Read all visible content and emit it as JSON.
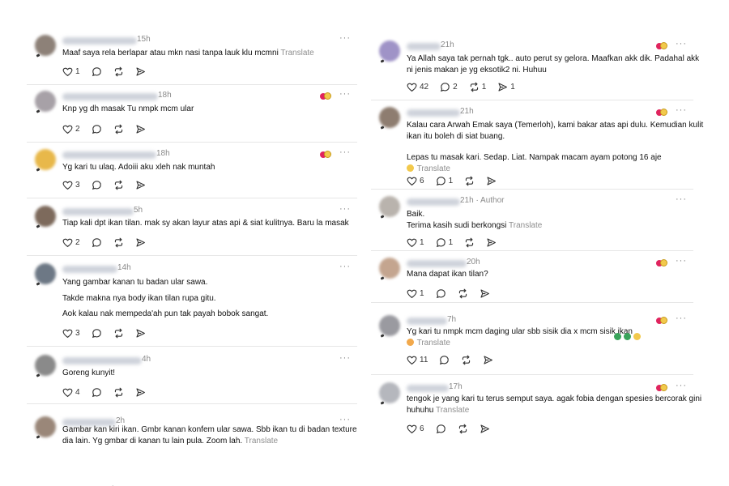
{
  "left_posts": [
    {
      "time": "15h",
      "lines": [
        "Maaf saya rela berlapar atau mkn nasi tanpa lauk klu mcmni"
      ],
      "translate": "Translate",
      "likes": "1",
      "replies": "",
      "reposts": "",
      "shares": "",
      "has_reactions": false,
      "avatar_color": "#8d8178"
    },
    {
      "time": "18h",
      "lines": [
        "Knp yg dh masak Tu nmpk mcm ular"
      ],
      "translate": "",
      "likes": "2",
      "replies": "",
      "reposts": "",
      "shares": "",
      "has_reactions": true,
      "avatar_color": "#a7a1a7"
    },
    {
      "time": "18h",
      "lines": [
        "Yg kari tu ulaq. Adoiii aku xleh nak muntah"
      ],
      "translate": "",
      "likes": "3",
      "replies": "",
      "reposts": "",
      "shares": "",
      "has_reactions": true,
      "avatar_color": "#e8b84a"
    },
    {
      "time": "5h",
      "lines": [
        "Tiap kali dpt ikan tilan. mak sy akan layur atas api & siat kulitnya. Baru la masak"
      ],
      "translate": "",
      "likes": "2",
      "replies": "",
      "reposts": "",
      "shares": "",
      "has_reactions": false,
      "avatar_color": "#7d6a5c"
    },
    {
      "time": "14h",
      "lines": [
        "Yang gambar kanan tu badan ular sawa.",
        "Takde makna nya body ikan tilan rupa gitu.",
        "Aok kalau nak mempeda'ah pun tak payah bobok sangat."
      ],
      "translate": "",
      "likes": "3",
      "replies": "",
      "reposts": "",
      "shares": "",
      "has_reactions": false,
      "avatar_color": "#6d7885"
    },
    {
      "time": "4h",
      "lines": [
        "Goreng kunyit!"
      ],
      "translate": "",
      "likes": "4",
      "replies": "",
      "reposts": "",
      "shares": "",
      "has_reactions": false,
      "avatar_color": "#8a8a8a"
    },
    {
      "time": "2h",
      "lines": [
        "Gambar kan kiri ikan. Gmbr kanan konfem ular sawa. Sbb ikan tu di badan texture",
        "dia lain. Yg gmbar di kanan tu lain pula. Zoom lah."
      ],
      "translate": "Translate",
      "likes": "",
      "replies": "",
      "reposts": "",
      "shares": "",
      "has_reactions": false,
      "avatar_color": "#9a8779"
    }
  ],
  "right_posts": [
    {
      "time": "21h",
      "lines": [
        "Ya Allah saya tak pernah tgk.. auto perut sy gelora. Maafkan akk dik. Padahal akk",
        "ni jenis makan je yg eksotik2 ni. Huhuu"
      ],
      "translate": "",
      "likes": "42",
      "replies": "2",
      "reposts": "1",
      "shares": "1",
      "has_reactions": true,
      "avatar_color": "#9f93c7"
    },
    {
      "time": "21h",
      "lines": [
        "Kalau cara Arwah Emak saya (Temerloh), kami bakar atas api dulu. Kemudian kulit",
        "ikan itu boleh di siat buang.",
        "",
        "Lepas tu masak kari. Sedap. Liat. Nampak macam ayam potong 16 aje"
      ],
      "translate": "Translate",
      "likes": "6",
      "replies": "1",
      "reposts": "",
      "shares": "",
      "has_reactions": true,
      "avatar_color": "#8e7d70"
    },
    {
      "time": "21h · Author",
      "lines": [
        "Baik.",
        "Terima kasih sudi berkongsi"
      ],
      "translate": "Translate",
      "likes": "1",
      "replies": "1",
      "reposts": "",
      "shares": "",
      "has_reactions": false,
      "avatar_color": "#b9b3ad"
    },
    {
      "time": "20h",
      "lines": [
        "Mana dapat ikan tilan?"
      ],
      "translate": "",
      "likes": "1",
      "replies": "",
      "reposts": "",
      "shares": "",
      "has_reactions": true,
      "avatar_color": "#c4a58f"
    },
    {
      "time": "7h",
      "lines": [
        "Yg kari tu nmpk mcm daging ular sbb sisik dia x mcm sisik ikan"
      ],
      "translate": "Translate",
      "likes": "11",
      "replies": "",
      "reposts": "",
      "shares": "",
      "has_reactions": true,
      "avatar_color": "#9a9aa0"
    },
    {
      "time": "17h",
      "lines": [
        "tengok je yang kari tu terus semput saya. agak fobia dengan spesies bercorak gini",
        "huhuhu"
      ],
      "translate": "Translate",
      "likes": "6",
      "replies": "",
      "reposts": "",
      "shares": "",
      "has_reactions": true,
      "avatar_color": "#b5b7bd"
    }
  ],
  "colors": {
    "reaction_love": "#e0245e",
    "reaction_emoji": "#f2c94c",
    "emoji_green": "#3aa35b"
  },
  "icons": [
    "heart-icon",
    "reply-icon",
    "repost-icon",
    "share-icon",
    "more-icon"
  ]
}
